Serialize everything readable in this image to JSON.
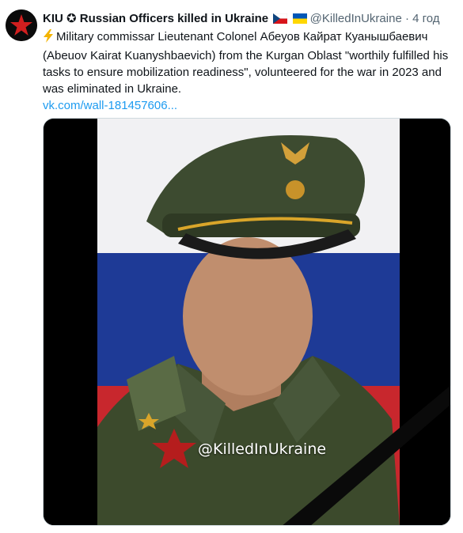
{
  "tweet": {
    "author_name": "KIU ✪ Russian Officers killed in Ukraine",
    "handle": "@KilledInUkraine",
    "separator": "·",
    "time": "4 год",
    "text": "Military commissar Lieutenant Colonel Абеуов Кайрат Куанышбаевич (Abeuov Kairat Kuanyshbaevich) from the Kurgan Oblast \"worthily fulfilled his tasks to ensure mobilization readiness\", volunteered for the war in 2023 and was eliminated in Ukraine.",
    "link": "vk.com/wall-181457606...",
    "watermark": "@KilledInUkraine",
    "icons": [
      "red-star-avatar-icon",
      "verified-icon",
      "czech-flag-icon",
      "ukraine-flag-icon",
      "lightning-icon",
      "mourning-ribbon-icon"
    ]
  },
  "colors": {
    "link": "#1d9bf0",
    "secondary_text": "#536471",
    "flag_white": "#f3f3f3",
    "flag_blue": "#1e3a96",
    "flag_red": "#c8272d",
    "uniform_green": "#3c4a2c"
  }
}
